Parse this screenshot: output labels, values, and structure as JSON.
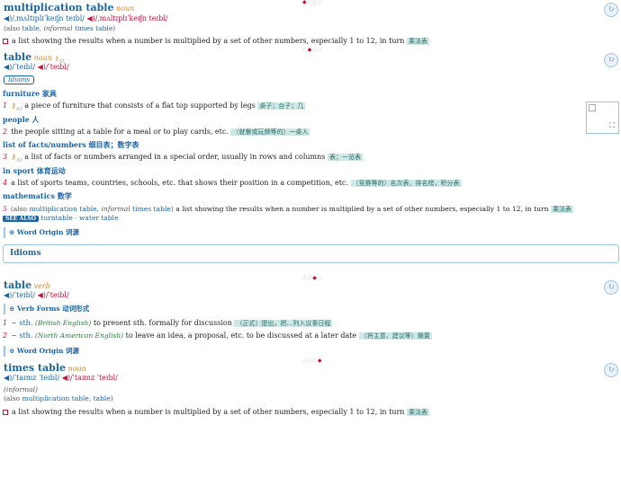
{
  "e1": {
    "headword": "multiplication table",
    "pos": "noun",
    "pron_uk": "/ˌmʌltɪplɪˈkeɪʃn teɪbl/",
    "pron_us": "/ˌmʌltɪplɪˈkeɪʃn teɪbl/",
    "also_prefix": "(also ",
    "also_word": "table,",
    "also_inf": "informal",
    "also_word2": "times table",
    "also_suffix": ")",
    "def": "a list showing the results when a number is multiplied by a set of other numbers, especially 1 to 12, in turn",
    "cn": "乘法表"
  },
  "e2": {
    "headword": "table",
    "pos": "noun",
    "level": "A1",
    "pron_uk": "/ˈteɪbl/",
    "pron_us": "/ˈteɪbl/",
    "idioms_btn": "Idioms",
    "g1": "furniture 家具",
    "s1_num": "1",
    "s1_level": "A1",
    "s1_def": "a piece of furniture that consists of a flat top supported by legs",
    "s1_cn": "桌子；台子；几",
    "g2": "people 人",
    "s2_num": "2",
    "s2_def": "the people sitting at a table for a meal or to play cards, etc.",
    "s2_cn": "（就餐或玩牌等的）一桌人",
    "g3": "list of facts/numbers 细目表；数字表",
    "s3_num": "3",
    "s3_level": "A2",
    "s3_def": "a list of facts or numbers arranged in a special order, usually in rows and columns",
    "s3_cn": "表；一览表",
    "g4": "in sport 体育运动",
    "s4_num": "4",
    "s4_def": "a list of sports teams, countries, schools, etc. that shows their position in a competition, etc.",
    "s4_cn": "（竞赛等的）名次表，排名榜，积分表",
    "g5": "mathematics 数学",
    "s5_num": "5",
    "s5_also": "(also",
    "s5_link1": "multiplication table,",
    "s5_inf": "informal",
    "s5_link2": "times table",
    "s5_close": ")",
    "s5_def": "a list showing the results when a number is multiplied by a set of other numbers, especially 1 to 12, in turn",
    "s5_cn": "乘法表",
    "see_also": "SEE ALSO",
    "see_links": "turntable · water table",
    "origin": "Word Origin 词源"
  },
  "idioms_header": "Idioms",
  "e3": {
    "headword": "table",
    "pos": "verb",
    "pron_uk": "/ˈteɪbl/",
    "pron_us": "/ˈteɪbl/",
    "verb_forms": "Verb Forms 动词形式",
    "s1_num": "1",
    "s1_obj": "~ sth.",
    "s1_reg": "(British English)",
    "s1_def": "to present sth. formally for discussion",
    "s1_cn": "（正式）提出，把…列入议事日程",
    "s2_num": "2",
    "s2_obj": "~ sth.",
    "s2_reg": "(North American English)",
    "s2_def": "to leave an idea, a proposal, etc. to be discussed at a later date",
    "s2_cn": "（将主意、建议等）搁置",
    "origin": "Word Origin 词源"
  },
  "e4": {
    "headword": "times table",
    "pos": "noun",
    "pron_uk": "/ˈtaɪmz ˈteɪbl/",
    "pron_us": "/ˈtaɪmz ˈteɪbl/",
    "reg": "(informal)",
    "also_prefix": "(also ",
    "also_link": "multiplication table, table",
    "also_suffix": ")",
    "def": "a list showing the results when a number is multiplied by a set of other numbers, especially 1 to 12, in turn",
    "cn": "乘法表"
  },
  "icons": {
    "speaker": "speaker-icon",
    "refresh": "refresh-icon",
    "star": "star-icon"
  },
  "colors": {
    "headword": "#1a64a6",
    "pos": "#d4882a",
    "accent_red": "#c2103a",
    "cn_bg": "#cfe8e6"
  }
}
